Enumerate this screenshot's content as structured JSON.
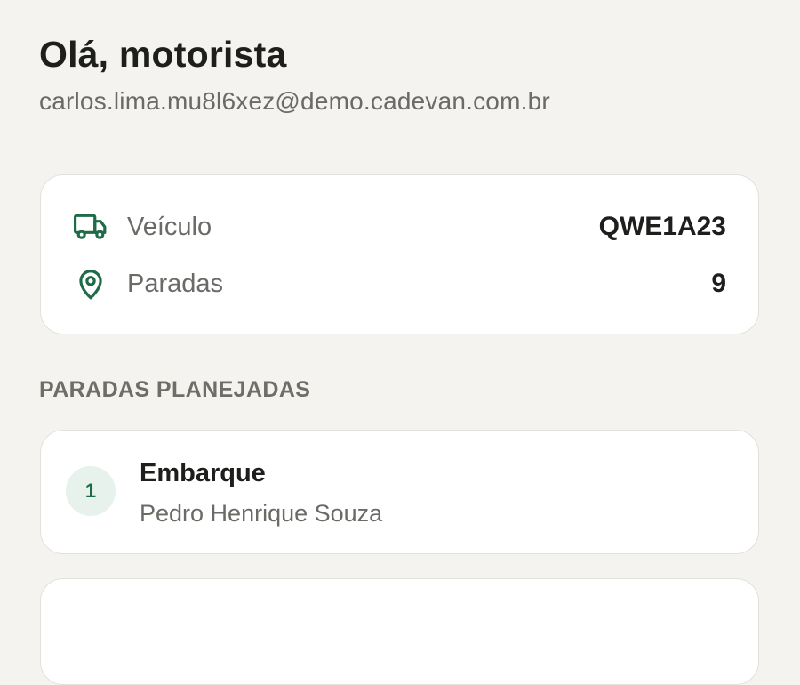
{
  "header": {
    "greeting": "Olá, motorista",
    "email": "carlos.lima.mu8l6xez@demo.cadevan.com.br"
  },
  "summary": {
    "vehicle": {
      "icon": "truck-icon",
      "label": "Veículo",
      "value": "QWE1A23"
    },
    "stops": {
      "icon": "map-pin-icon",
      "label": "Paradas",
      "value": "9"
    }
  },
  "planned_stops": {
    "title": "PARADAS PLANEJADAS",
    "items": [
      {
        "number": "1",
        "type": "Embarque",
        "person": "Pedro Henrique Souza"
      }
    ]
  },
  "colors": {
    "background": "#f4f3ef",
    "accent": "#1f6a47",
    "accent_soft": "#e6f2eb",
    "text_primary": "#1e1f1c",
    "text_secondary": "#6a6a66"
  }
}
